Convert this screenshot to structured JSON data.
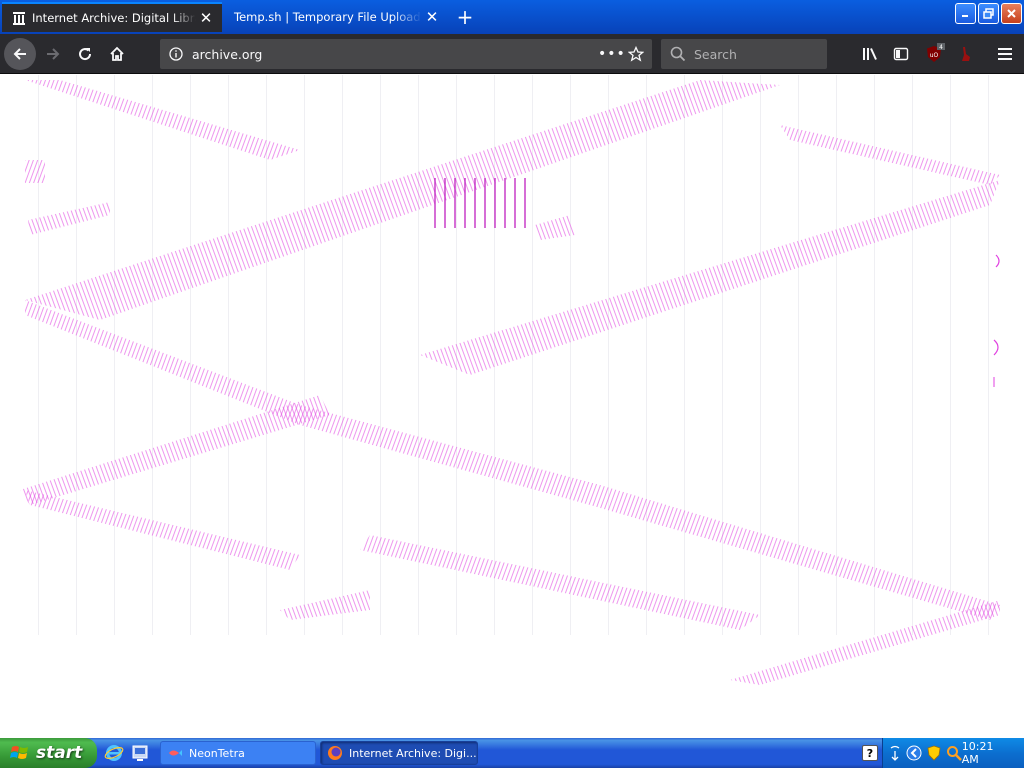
{
  "browser": {
    "tabs": [
      {
        "title": "Internet Archive: Digital Library of Free & Borrowable Books, Movies, Music & Wayback Machine",
        "active": true
      },
      {
        "title": "Temp.sh | Temporary File Upload",
        "active": false
      }
    ],
    "url": "archive.org",
    "search_placeholder": "Search",
    "page_actions": "•••",
    "ublock_badge": "4"
  },
  "taskbar": {
    "start_label": "start",
    "items": [
      {
        "label": "NeonTetra"
      },
      {
        "label": "Internet Archive: Digi..."
      }
    ],
    "help_label": "?",
    "clock": "10:21 AM"
  },
  "colors": {
    "accent": "#0a84ff",
    "toolbar": "#2a2a2e",
    "artifact": "#e040e0"
  }
}
